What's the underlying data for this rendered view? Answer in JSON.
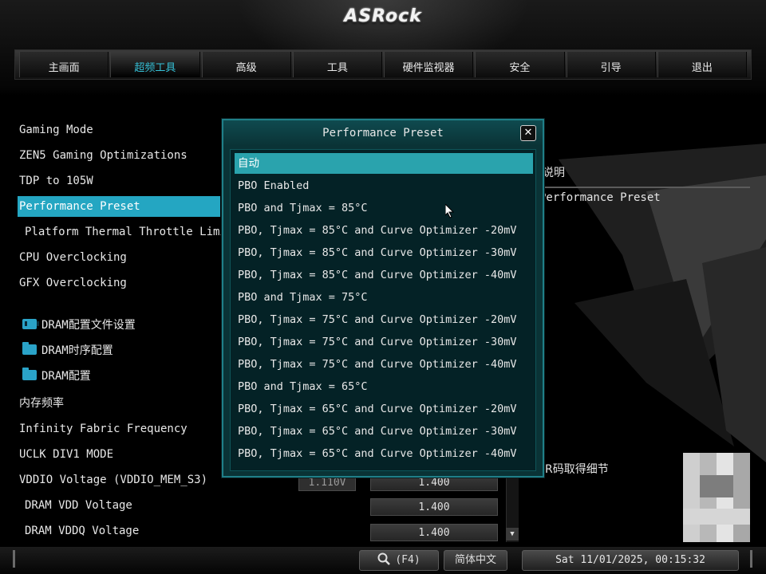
{
  "brand": "ASRock",
  "tabs": [
    {
      "label": "主画面",
      "active": false
    },
    {
      "label": "超频工具",
      "active": true
    },
    {
      "label": "高级",
      "active": false
    },
    {
      "label": "工具",
      "active": false
    },
    {
      "label": "硬件监视器",
      "active": false
    },
    {
      "label": "安全",
      "active": false
    },
    {
      "label": "引导",
      "active": false
    },
    {
      "label": "退出",
      "active": false
    }
  ],
  "menu": {
    "items": [
      {
        "label": "Gaming Mode"
      },
      {
        "label": "ZEN5 Gaming Optimizations"
      },
      {
        "label": "TDP to 105W"
      },
      {
        "label": "Performance Preset",
        "selected": true
      },
      {
        "label": "Platform Thermal Throttle Limit(℃)"
      },
      {
        "label": "CPU Overclocking"
      },
      {
        "label": "GFX Overclocking"
      },
      {
        "label": "DRAM配置文件设置",
        "icon": "memory-icon"
      },
      {
        "label": "DRAM时序配置",
        "icon": "folder-icon"
      },
      {
        "label": "DRAM配置",
        "icon": "folder-icon"
      },
      {
        "label": "内存频率"
      },
      {
        "label": "Infinity Fabric Frequency"
      },
      {
        "label": "UCLK DIV1 MODE"
      },
      {
        "label": "VDDIO Voltage (VDDIO_MEM_S3)"
      },
      {
        "label": "DRAM VDD Voltage"
      },
      {
        "label": "DRAM VDDQ Voltage"
      }
    ],
    "vddio_current": "1.110V",
    "vddio_value": "1.400",
    "dram_vdd_value": "1.400",
    "dram_vddq_value": "1.400"
  },
  "description": {
    "title": "说明",
    "text": "Performance Preset",
    "qr_text": "QR码取得细节"
  },
  "dialog": {
    "title": "Performance Preset",
    "close_label": "✕",
    "options": [
      {
        "label": "自动",
        "selected": true
      },
      {
        "label": "PBO Enabled"
      },
      {
        "label": "PBO and Tjmax = 85°C"
      },
      {
        "label": "PBO, Tjmax = 85°C and Curve Optimizer -20mV"
      },
      {
        "label": "PBO, Tjmax = 85°C and Curve Optimizer -30mV"
      },
      {
        "label": "PBO, Tjmax = 85°C and Curve Optimizer -40mV"
      },
      {
        "label": "PBO and Tjmax = 75°C"
      },
      {
        "label": "PBO, Tjmax = 75°C and Curve Optimizer -20mV"
      },
      {
        "label": "PBO, Tjmax = 75°C and Curve Optimizer -30mV"
      },
      {
        "label": "PBO, Tjmax = 75°C and Curve Optimizer -40mV"
      },
      {
        "label": "PBO and Tjmax = 65°C"
      },
      {
        "label": "PBO, Tjmax = 65°C and Curve Optimizer -20mV"
      },
      {
        "label": "PBO, Tjmax = 65°C and Curve Optimizer -30mV"
      },
      {
        "label": "PBO, Tjmax = 65°C and Curve Optimizer -40mV"
      }
    ]
  },
  "bottombar": {
    "search_label": "(F4)",
    "language": "简体中文",
    "datetime": "Sat 11/01/2025, 00:15:32"
  },
  "colors": {
    "accent": "#24a6c2",
    "dialog_bg": "#0a3336",
    "dialog_selected": "#2aa3ad"
  }
}
